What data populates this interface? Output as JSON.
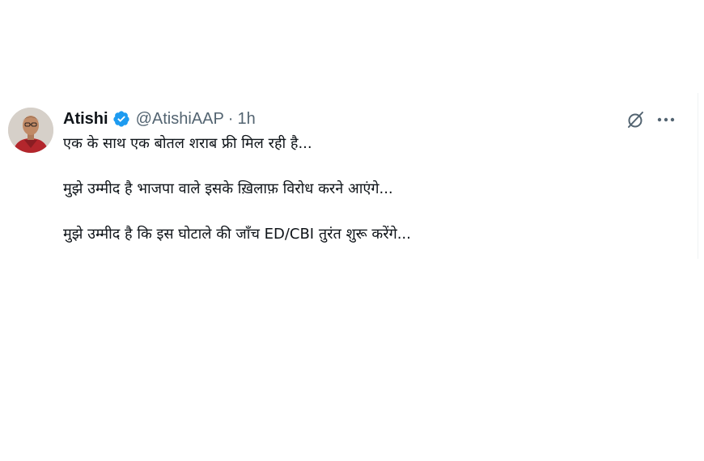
{
  "tweet": {
    "author": {
      "display_name": "Atishi",
      "handle": "@AtishiAAP",
      "separator": "·",
      "time": "1h",
      "verified": true,
      "avatar_icon": "user-avatar"
    },
    "icons": {
      "grok": "grok-icon",
      "more": "more-icon",
      "verified": "verified-badge-icon"
    },
    "colors": {
      "verified_badge": "#1d9bf0",
      "secondary_text": "#536471",
      "primary_text": "#0f1419"
    },
    "lines": [
      "एक के साथ एक बोतल शराब फ्री मिल रही है...",
      "मुझे उम्मीद है भाजपा वाले इसके ख़िलाफ़ विरोध करने आएंगे...",
      "मुझे उम्मीद है कि इस घोटाले की जाँच ED/CBI तुरंत शुरू करेंगे..."
    ]
  }
}
